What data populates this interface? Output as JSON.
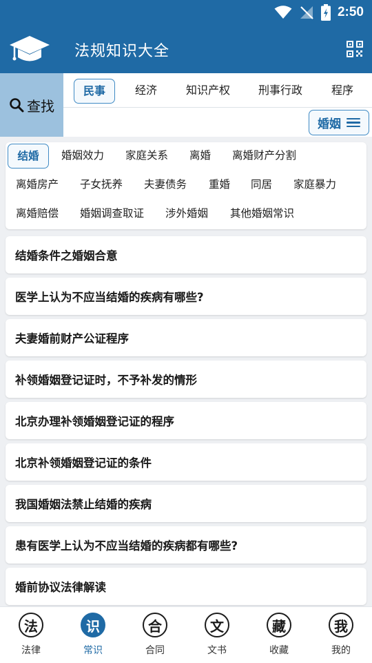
{
  "status": {
    "time": "2:50"
  },
  "app": {
    "title": "法规知识大全"
  },
  "search": {
    "label": "查找"
  },
  "categories": [
    "民事",
    "经济",
    "知识产权",
    "刑事行政",
    "程序"
  ],
  "subcategory": {
    "selected": "婚姻"
  },
  "topics": [
    "结婚",
    "婚姻效力",
    "家庭关系",
    "离婚",
    "离婚财产分割",
    "离婚房产",
    "子女抚养",
    "夫妻债务",
    "重婚",
    "同居",
    "家庭暴力",
    "离婚赔偿",
    "婚姻调查取证",
    "涉外婚姻",
    "其他婚姻常识"
  ],
  "articles": [
    "结婚条件之婚姻合意",
    "医学上认为不应当结婚的疾病有哪些?",
    "夫妻婚前财产公证程序",
    "补领婚姻登记证时，不予补发的情形",
    "北京办理补领婚姻登记证的程序",
    "北京补领婚姻登记证的条件",
    "我国婚姻法禁止结婚的疾病",
    "患有医学上认为不应当结婚的疾病都有哪些?",
    "婚前协议法律解读"
  ],
  "nav": [
    {
      "icon": "法",
      "label": "法律"
    },
    {
      "icon": "识",
      "label": "常识"
    },
    {
      "icon": "合",
      "label": "合同"
    },
    {
      "icon": "文",
      "label": "文书"
    },
    {
      "icon": "藏",
      "label": "收藏"
    },
    {
      "icon": "我",
      "label": "我的"
    }
  ],
  "colors": {
    "primary": "#1f6aa5",
    "search_bg": "#9cc1de",
    "accent_border": "#3f8ac4"
  }
}
